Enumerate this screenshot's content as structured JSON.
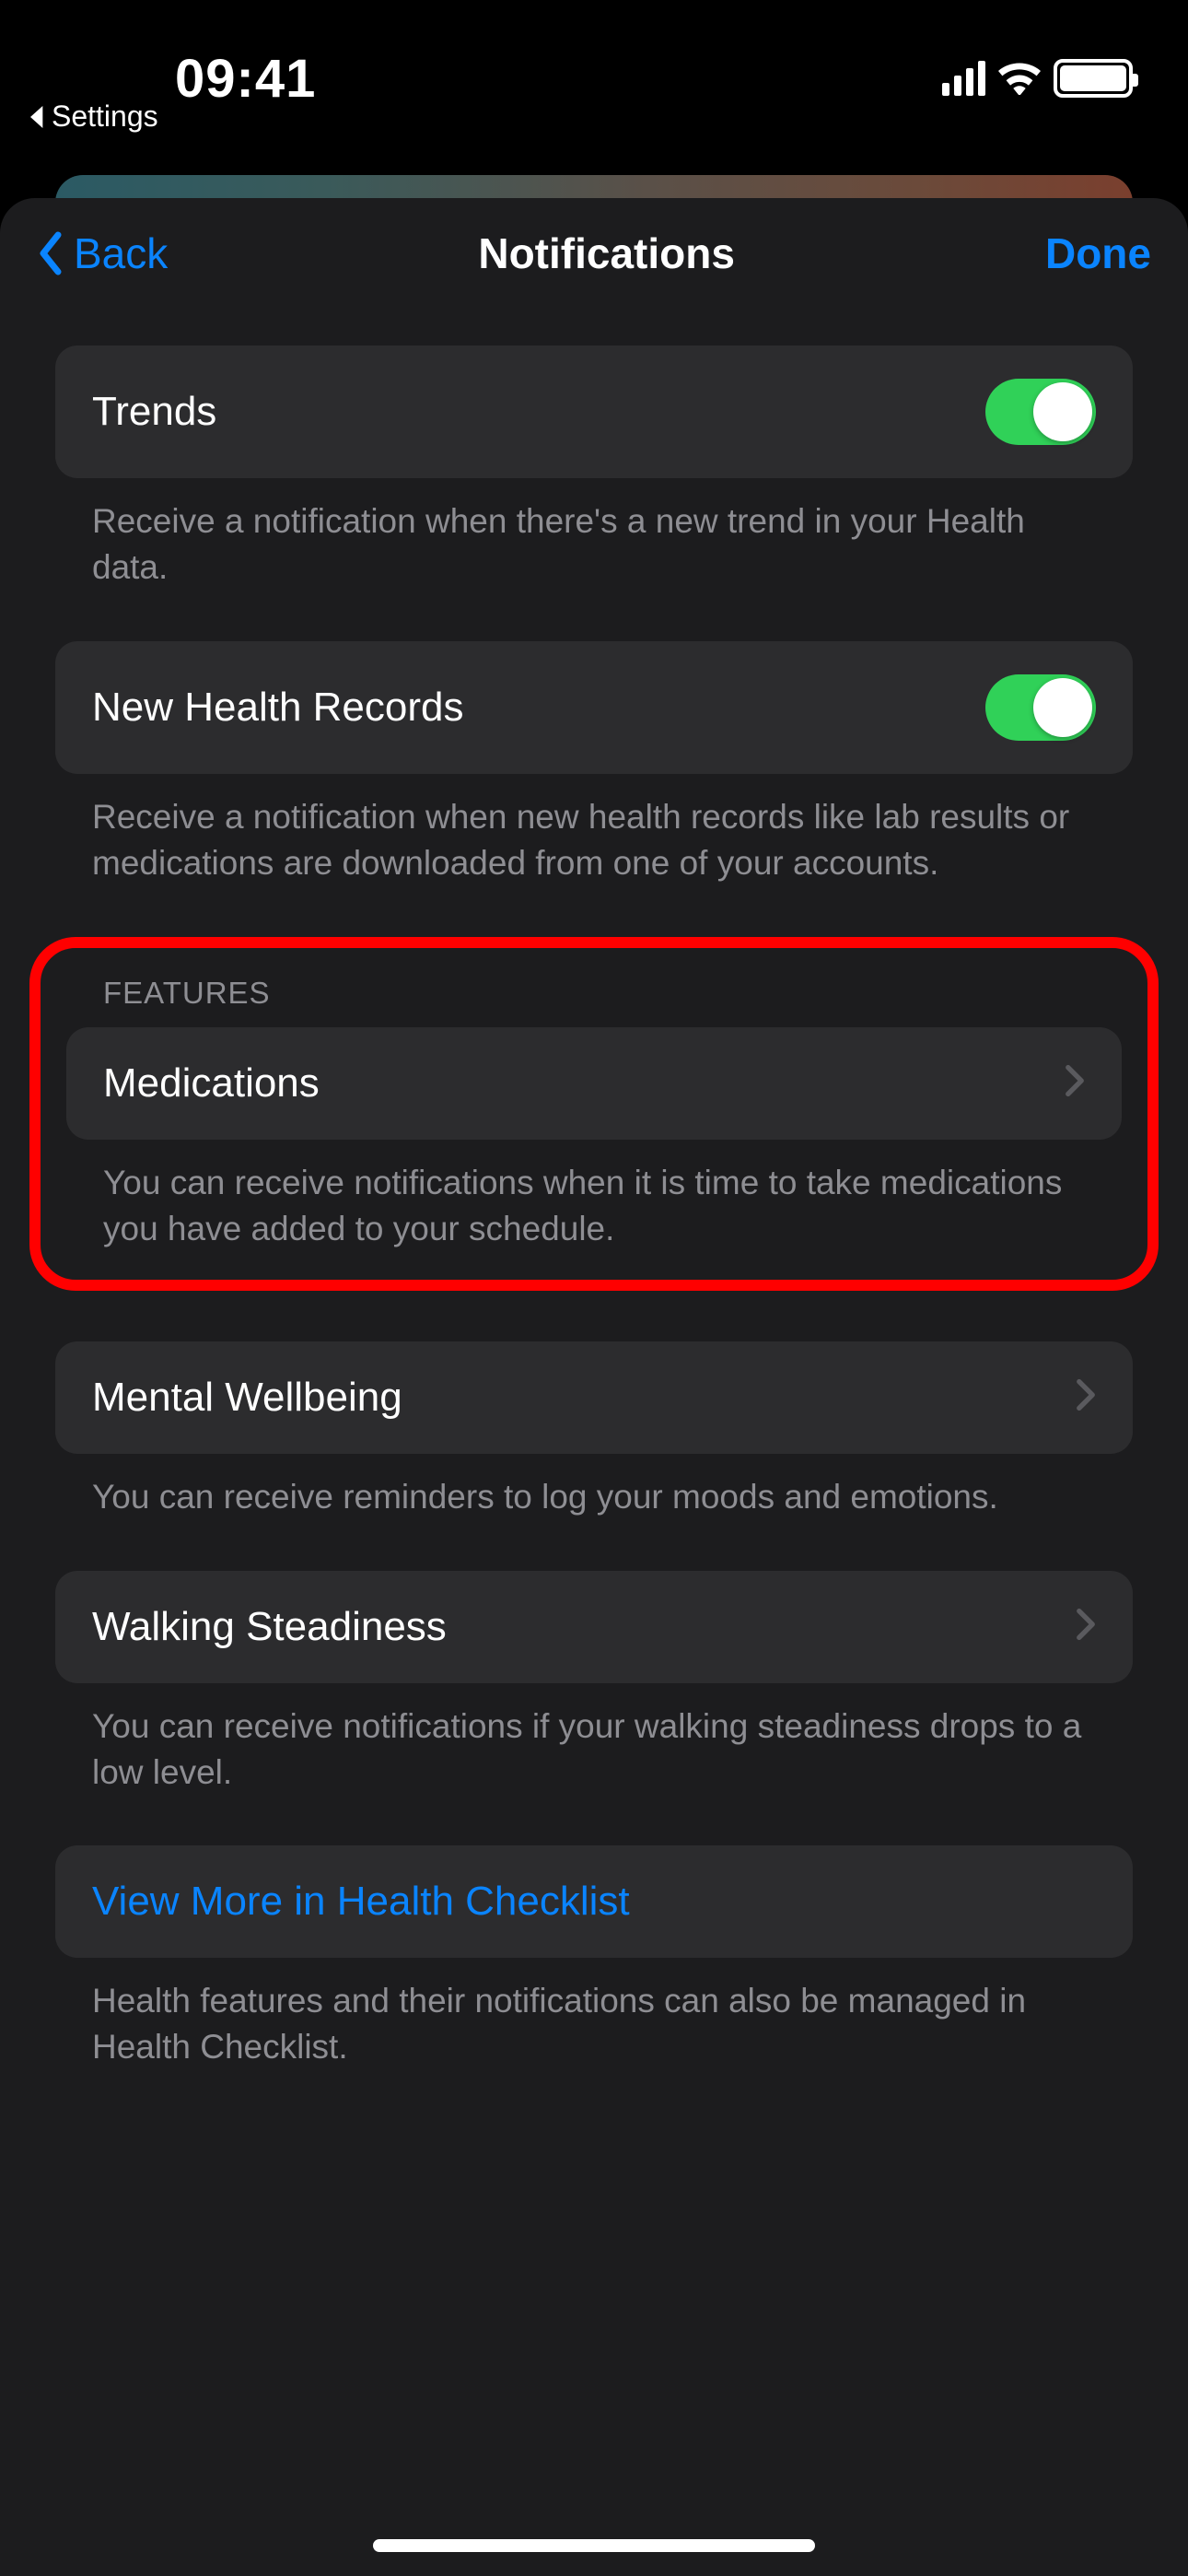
{
  "status": {
    "time": "09:41"
  },
  "breadcrumb": {
    "label": "Settings"
  },
  "nav": {
    "back": "Back",
    "title": "Notifications",
    "done": "Done"
  },
  "trends": {
    "title": "Trends",
    "footer": "Receive a notification when there's a new trend in your Health data."
  },
  "records": {
    "title": "New Health Records",
    "footer": "Receive a notification when new health records like lab results or medications are downloaded from one of your accounts."
  },
  "features": {
    "header": "FEATURES",
    "medications": {
      "title": "Medications",
      "footer": "You can receive notifications when it is time to take medications you have added to your schedule."
    },
    "mental": {
      "title": "Mental Wellbeing",
      "footer": "You can receive reminders to log your moods and emotions."
    },
    "walking": {
      "title": "Walking Steadiness",
      "footer": "You can receive notifications if your walking steadiness drops to a low level."
    }
  },
  "checklist": {
    "title": "View More in Health Checklist",
    "footer": "Health features and their notifications can also be managed in Health Checklist."
  }
}
